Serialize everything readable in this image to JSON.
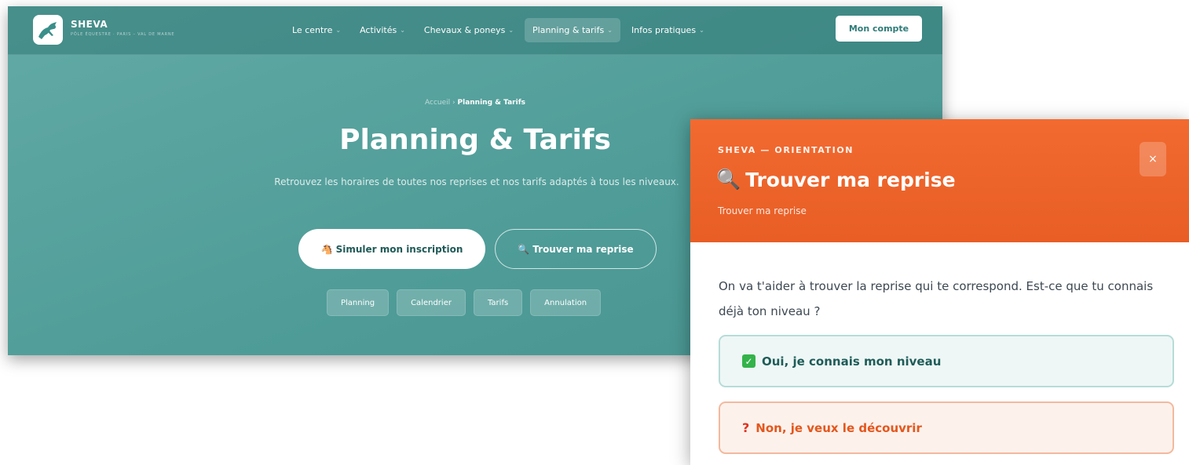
{
  "site": {
    "brand": {
      "name": "SHEVA",
      "tagline": "PÔLE ÉQUESTRE · PARIS – VAL DE MARNE",
      "logo_icon": "horse-jumping-icon"
    },
    "nav": [
      {
        "label": "Le centre",
        "active": false
      },
      {
        "label": "Activités",
        "active": false
      },
      {
        "label": "Chevaux & poneys",
        "active": false
      },
      {
        "label": "Planning & tarifs",
        "active": true
      },
      {
        "label": "Infos pratiques",
        "active": false
      }
    ],
    "account_label": "Mon compte",
    "breadcrumb": {
      "home": "Accueil",
      "separator": "›",
      "current": "Planning & Tarifs"
    },
    "hero": {
      "title": "Planning & Tarifs",
      "subtitle": "Retrouvez les horaires de toutes nos reprises et nos tarifs adaptés à tous les niveaux.",
      "primary_icon": "🐴",
      "primary_button": "Simuler mon inscription",
      "secondary_icon": "🔍",
      "secondary_button": "Trouver ma reprise"
    },
    "subnav": [
      "Planning",
      "Calendrier",
      "Tarifs",
      "Annulation"
    ],
    "colors": {
      "teal": "#55a19d",
      "white": "#ffffff"
    }
  },
  "modal": {
    "eyebrow": "SHEVA — ORIENTATION",
    "title_icon": "🔍",
    "title": "Trouver ma reprise",
    "subtitle": "Trouver ma reprise",
    "close_label": "×",
    "question": "On va t'aider à trouver la reprise qui te correspond. Est-ce que tu connais déjà ton niveau ?",
    "options": [
      {
        "icon": "✓",
        "label": "Oui, je connais mon niveau"
      },
      {
        "icon": "?",
        "label": "Non, je veux le découvrir"
      }
    ],
    "colors": {
      "header": "#ec6329",
      "yes_border": "#b6dcd8",
      "no_border": "#f3b99e"
    }
  }
}
